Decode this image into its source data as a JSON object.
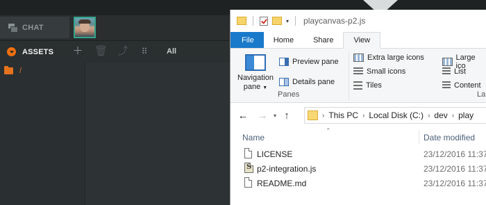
{
  "editor": {
    "chat_label": "CHAT",
    "assets_label": "ASSETS",
    "filter_label": "All",
    "root_folder_label": "/",
    "tools": [
      "plus-icon",
      "trash-icon",
      "replace-icon",
      "grid-icon"
    ]
  },
  "explorer": {
    "title": "playcanvas-p2.js",
    "tabs": [
      "File",
      "Home",
      "Share",
      "View"
    ],
    "active_tab": "View",
    "ribbon": {
      "navigation_pane_label_line1": "Navigation",
      "navigation_pane_label_line2": "pane",
      "preview_pane": "Preview pane",
      "details_pane": "Details pane",
      "panes_group": "Panes",
      "layout_items": [
        "Extra large icons",
        "Large ico",
        "Small icons",
        "List",
        "Tiles",
        "Content"
      ],
      "layout_group": "La"
    },
    "address": {
      "crumbs": [
        "This PC",
        "Local Disk (C:)",
        "dev",
        "play"
      ]
    },
    "columns": {
      "name": "Name",
      "date_modified": "Date modified"
    },
    "files": [
      {
        "name": "LICENSE",
        "date": "23/12/2016 11:37",
        "icon": "generic-file-icon"
      },
      {
        "name": "p2-integration.js",
        "date": "23/12/2016 11:37",
        "icon": "js-file-icon"
      },
      {
        "name": "README.md",
        "date": "23/12/2016 11:37",
        "icon": "generic-file-icon"
      }
    ]
  },
  "colors": {
    "editor_accent": "#e5721c",
    "file_tab_blue": "#1979ca"
  }
}
